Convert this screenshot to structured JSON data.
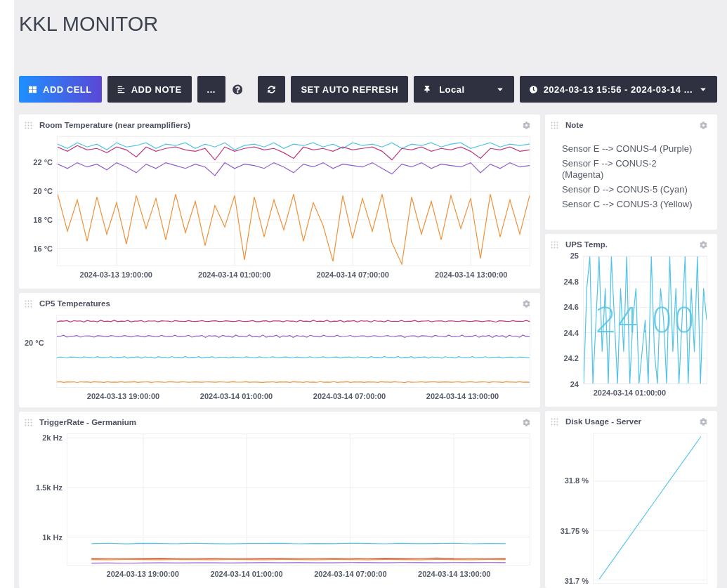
{
  "page_title": "KKL MONITOR",
  "toolbar": {
    "add_cell": {
      "label": "ADD CELL"
    },
    "add_note": {
      "label": "ADD NOTE"
    },
    "more": {
      "label": "..."
    },
    "auto_refresh": {
      "label": "SET AUTO REFRESH"
    },
    "timezone": {
      "value": "Local"
    },
    "time_range": {
      "value": "2024-03-13 15:56 - 2024-03-14 ..."
    }
  },
  "columns": [
    {
      "cells": [
        {
          "kind": "line_chart",
          "title": "Room Temperature (near preamplifiers)",
          "chart_data": {
            "type": "line",
            "grid": true,
            "categories": [
              null,
              null,
              null,
              null,
              null,
              null,
              "2024-03-13 19:00:00",
              null,
              null,
              null,
              null,
              null,
              null,
              null,
              null,
              null,
              null,
              null,
              "2024-03-14 01:00:00",
              null,
              null,
              null,
              null,
              null,
              null,
              null,
              null,
              null,
              null,
              null,
              "2024-03-14 07:00:00",
              null,
              null,
              null,
              null,
              null,
              null,
              null,
              null,
              null,
              null,
              null,
              "2024-03-14 13:00:00",
              null,
              null,
              null,
              null,
              null,
              null
            ],
            "ylim": [
              14.8,
              23.8
            ],
            "yticks": [
              {
                "value": 16,
                "label": "16 °C"
              },
              {
                "value": 18,
                "label": "18 °C"
              },
              {
                "value": 20,
                "label": "20 °C"
              },
              {
                "value": 22,
                "label": "22 °C"
              }
            ],
            "series": [
              {
                "color": "#4fc3e8",
                "values": [
                  23.3,
                  23.0,
                  23.4,
                  23.1,
                  23.3,
                  22.9,
                  23.4,
                  23.1,
                  23.2,
                  23.4,
                  23.0,
                  23.3,
                  23.2,
                  23.4,
                  23.0,
                  23.3,
                  23.1,
                  23.4,
                  22.9,
                  23.2,
                  23.3,
                  23.1,
                  23.4,
                  23.0,
                  23.3,
                  23.2,
                  23.4,
                  23.1,
                  23.3,
                  23.0,
                  23.4,
                  23.2,
                  23.3,
                  23.1,
                  23.4,
                  23.0,
                  23.3,
                  23.2,
                  23.4,
                  23.1,
                  23.3,
                  23.4,
                  23.0,
                  23.2,
                  23.4,
                  23.1,
                  23.3,
                  23.2,
                  23.3
                ]
              },
              {
                "color": "#c0397b",
                "values": [
                  23.1,
                  22.8,
                  23.2,
                  22.9,
                  23.0,
                  22.7,
                  23.1,
                  22.9,
                  22.4,
                  23.1,
                  22.8,
                  23.0,
                  23.1,
                  22.9,
                  22.8,
                  23.0,
                  22.2,
                  23.1,
                  22.8,
                  23.0,
                  23.1,
                  22.9,
                  23.0,
                  22.7,
                  22.3,
                  23.1,
                  22.9,
                  23.0,
                  22.8,
                  23.1,
                  22.9,
                  23.0,
                  23.1,
                  22.8,
                  22.2,
                  23.0,
                  22.9,
                  23.1,
                  22.8,
                  23.0,
                  22.9,
                  23.1,
                  22.8,
                  22.3,
                  23.0,
                  22.9,
                  23.1,
                  22.8,
                  22.9
                ]
              },
              {
                "color": "#8e5ccf",
                "values": [
                  21.9,
                  21.6,
                  22.0,
                  21.7,
                  21.9,
                  21.5,
                  22.0,
                  21.7,
                  21.3,
                  21.9,
                  21.6,
                  22.0,
                  21.8,
                  21.6,
                  21.9,
                  21.7,
                  21.1,
                  22.0,
                  21.6,
                  21.9,
                  21.8,
                  21.6,
                  22.0,
                  21.7,
                  21.3,
                  21.9,
                  21.7,
                  22.0,
                  21.6,
                  21.9,
                  21.8,
                  21.7,
                  22.0,
                  21.6,
                  21.2,
                  21.9,
                  21.7,
                  22.0,
                  21.6,
                  21.9,
                  21.8,
                  21.7,
                  22.0,
                  21.3,
                  21.9,
                  21.6,
                  22.0,
                  21.7,
                  21.8
                ]
              },
              {
                "color": "#f0913a",
                "values": [
                  19.8,
                  17.2,
                  19.4,
                  16.5,
                  19.6,
                  17.0,
                  19.2,
                  16.3,
                  19.7,
                  17.4,
                  19.5,
                  16.6,
                  19.8,
                  17.1,
                  19.3,
                  16.2,
                  19.0,
                  17.5,
                  19.7,
                  15.2,
                  19.6,
                  16.8,
                  19.4,
                  17.3,
                  19.8,
                  16.5,
                  19.2,
                  17.6,
                  15.1,
                  19.7,
                  16.7,
                  19.5,
                  17.2,
                  19.8,
                  16.4,
                  14.9,
                  19.6,
                  17.0,
                  19.3,
                  16.6,
                  19.7,
                  17.4,
                  19.5,
                  15.3,
                  19.8,
                  16.8,
                  19.4,
                  17.0,
                  19.7
                ]
              }
            ]
          }
        },
        {
          "kind": "trace_picture",
          "title": "CP5 Temperatures",
          "y_tick_labels": [
            "20 °C"
          ],
          "x_tick_labels": [
            "2024-03-13 19:00:00",
            "2024-03-14 01:00:00",
            "2024-03-14 07:00:00",
            "2024-03-14 13:00:00"
          ]
        },
        {
          "kind": "line_chart",
          "title": "TriggerRate - Germanium",
          "chart_data": {
            "type": "line",
            "grid": true,
            "categories": [
              null,
              null,
              null,
              "2024-03-13 19:00:00",
              null,
              null,
              null,
              null,
              null,
              "2024-03-14 01:00:00",
              null,
              null,
              null,
              null,
              null,
              "2024-03-14 07:00:00",
              null,
              null,
              null,
              null,
              null,
              "2024-03-14 13:00:00",
              null,
              null,
              null
            ],
            "ylim": [
              720,
              2040
            ],
            "yticks": [
              {
                "value": 1000,
                "label": "1k Hz"
              },
              {
                "value": 1500,
                "label": "1.5k Hz"
              },
              {
                "value": 2000,
                "label": "2k Hz"
              }
            ],
            "series": [
              {
                "color": "#4fc3e8",
                "values": [
                  934,
                  938,
                  932,
                  937,
                  935,
                  933,
                  938,
                  934,
                  932,
                  936,
                  935,
                  937,
                  933,
                  936,
                  934,
                  938,
                  935,
                  933,
                  937,
                  934,
                  936,
                  938,
                  933,
                  935,
                  934
                ]
              },
              {
                "color": "#c0452a",
                "values": [
                  783,
                  782,
                  784,
                  783,
                  785,
                  782,
                  784,
                  783,
                  782,
                  784,
                  783,
                  785,
                  784,
                  782,
                  783,
                  784,
                  782,
                  785,
                  783,
                  784,
                  788,
                  783,
                  782,
                  784,
                  783
                ]
              },
              {
                "color": "#f0913a",
                "values": [
                  772,
                  771,
                  773,
                  772,
                  771,
                  773,
                  772,
                  771,
                  773,
                  772,
                  771,
                  773,
                  772,
                  771,
                  773,
                  772,
                  771,
                  773,
                  772,
                  771,
                  773,
                  772,
                  771,
                  773,
                  772
                ]
              },
              {
                "color": "#8e5ccf",
                "values": [
                  737,
                  738,
                  736,
                  739,
                  740,
                  738,
                  741,
                  740,
                  739,
                  741,
                  742,
                  741,
                  742,
                  740,
                  741,
                  743,
                  742,
                  741,
                  743,
                  742,
                  741,
                  743,
                  742,
                  743,
                  742
                ]
              }
            ]
          }
        }
      ]
    },
    {
      "cells": [
        {
          "kind": "note",
          "title": "Note",
          "lines": [
            "Sensor E --> CONUS-4 (Purple)",
            "Sensor F --> CONUS-2 (Magenta)",
            "Sensor D --> CONUS-5 (Cyan)",
            "Sensor C --> CONUS-3 (Yellow)"
          ]
        },
        {
          "kind": "line_chart",
          "title": "UPS Temp.",
          "stat": "24.00",
          "chart_data": {
            "type": "line",
            "grid": true,
            "categories": [
              null,
              null,
              null,
              null,
              null,
              null,
              null,
              null,
              null,
              null,
              null,
              null,
              null,
              null,
              null,
              "2024-03-14 01:00:00",
              null,
              null,
              null,
              null,
              null,
              null,
              null,
              null,
              null,
              null,
              null,
              null,
              null,
              null,
              null,
              null,
              null,
              null,
              null,
              null,
              null,
              null,
              null,
              null,
              null
            ],
            "ylim": [
              24,
              25
            ],
            "yticks": [
              {
                "value": 24,
                "label": "24"
              },
              {
                "value": 24.2,
                "label": "24.2"
              },
              {
                "value": 24.4,
                "label": "24.4"
              },
              {
                "value": 24.6,
                "label": "24.6"
              },
              {
                "value": 24.8,
                "label": "24.8"
              },
              {
                "value": 25,
                "label": "25"
              }
            ],
            "series": [
              {
                "color": "#4fc3e8",
                "values": [
                  24,
                  24.75,
                  25,
                  24,
                  24.5,
                  25,
                  24.25,
                  24.75,
                  24,
                  25,
                  24.5,
                  24,
                  24.75,
                  24.25,
                  25,
                  24,
                  24.5,
                  24.75,
                  24,
                  24.25,
                  24.5,
                  24,
                  25,
                  24.25,
                  24,
                  24.75,
                  24.5,
                  24,
                  25,
                  24.25,
                  24.75,
                  24,
                  24.5,
                  25,
                  24,
                  24.75,
                  24.25,
                  25,
                  24,
                  24.75,
                  24.5
                ]
              }
            ]
          }
        },
        {
          "kind": "line_chart",
          "title": "Disk Usage - Server",
          "chart_data": {
            "type": "line",
            "grid": true,
            "categories": [
              null,
              null,
              null,
              null,
              null,
              null,
              null,
              null,
              null,
              null
            ],
            "ylim": [
              31.697,
              31.848
            ],
            "yticks": [
              {
                "value": 31.7,
                "label": "31.7 %"
              },
              {
                "value": 31.75,
                "label": "31.75 %"
              },
              {
                "value": 31.8,
                "label": "31.8 %"
              }
            ],
            "series": [
              {
                "color": "#5bc8ee",
                "values": [
                  31.701,
                  31.717,
                  31.733,
                  31.749,
                  31.765,
                  31.781,
                  31.797,
                  31.813,
                  31.829,
                  31.845
                ]
              }
            ]
          }
        }
      ]
    }
  ]
}
